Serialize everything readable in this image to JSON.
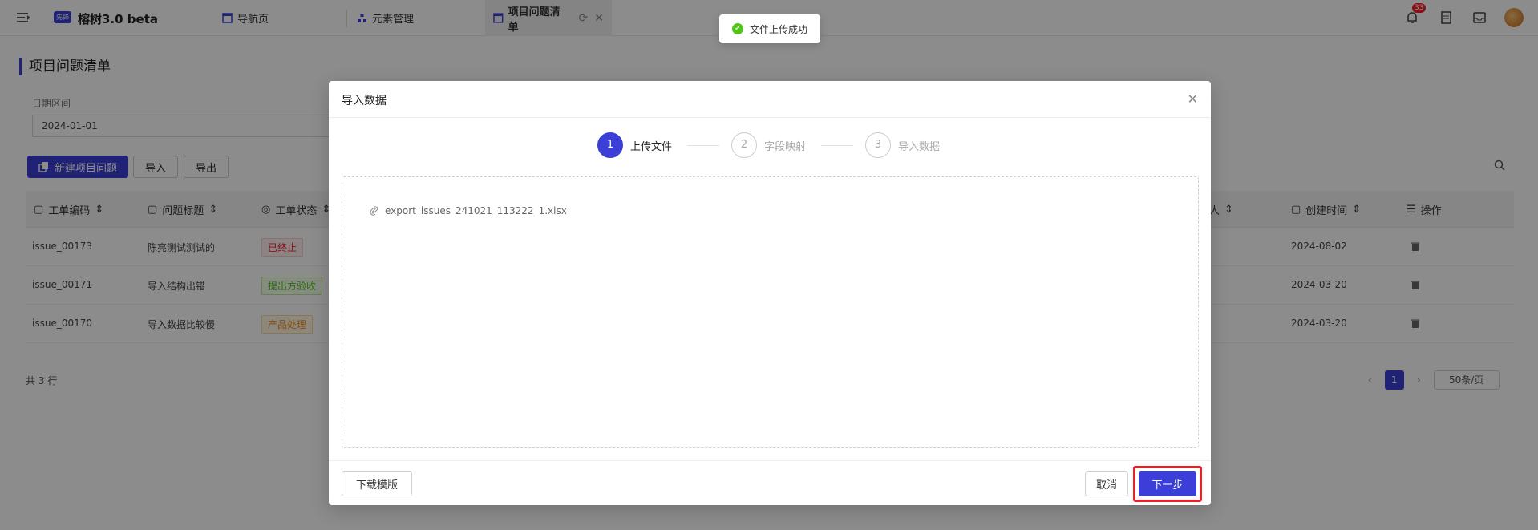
{
  "topbar": {
    "logo_badge": "先锋",
    "app_title": "榕树3.0 beta",
    "tabs": [
      {
        "label": "导航页"
      },
      {
        "label": "元素管理"
      },
      {
        "label": "项目问题清单"
      }
    ],
    "notification_count": "33"
  },
  "page": {
    "title": "项目问题清单",
    "filter_label": "日期区间",
    "filter_value": "2024-01-01",
    "btn_new": "新建项目问题",
    "btn_import": "导入",
    "btn_export": "导出"
  },
  "table": {
    "headers": [
      "工单编码",
      "问题标题",
      "工单状态",
      "人",
      "创建时间",
      "操作"
    ],
    "rows": [
      {
        "code": "issue_00173",
        "title": "陈亮测试测试的",
        "status": "已终止",
        "date": "2024-08-02"
      },
      {
        "code": "issue_00171",
        "title": "导入结构出错",
        "status": "提出方验收",
        "date": "2024-03-20"
      },
      {
        "code": "issue_00170",
        "title": "导入数据比较慢",
        "status": "产品处理",
        "date": "2024-03-20"
      }
    ],
    "total": "共 3 行",
    "current_page": "1",
    "page_size": "50条/页"
  },
  "toast": {
    "message": "文件上传成功"
  },
  "modal": {
    "title": "导入数据",
    "steps": [
      {
        "num": "1",
        "label": "上传文件"
      },
      {
        "num": "2",
        "label": "字段映射"
      },
      {
        "num": "3",
        "label": "导入数据"
      }
    ],
    "file_name": "export_issues_241021_113222_1.xlsx",
    "btn_download": "下载模版",
    "btn_cancel": "取消",
    "btn_next": "下一步"
  },
  "colors": {
    "primary": "#3b3fd8",
    "highlight": "#e8202a",
    "success": "#52c41a"
  }
}
